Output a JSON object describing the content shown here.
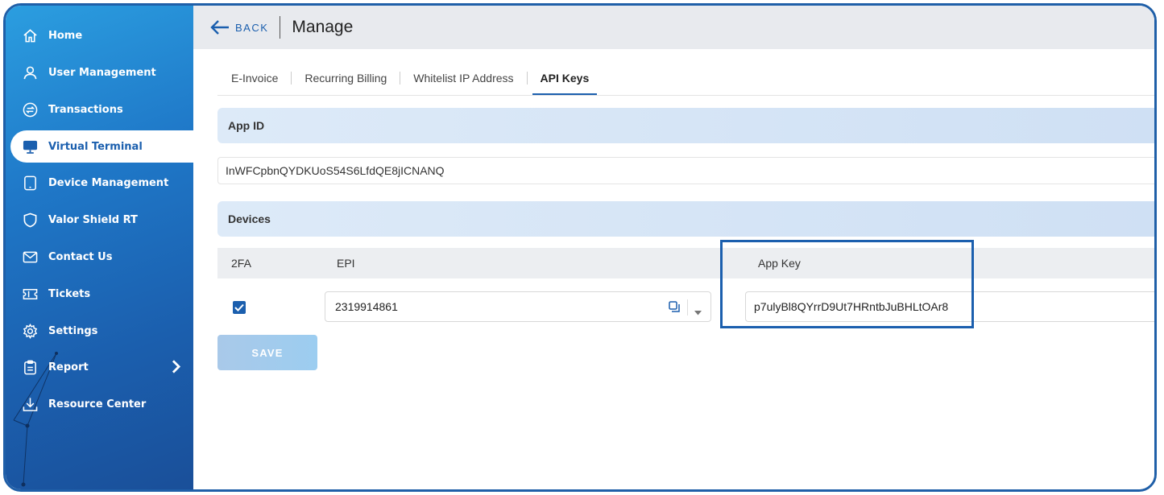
{
  "sidebar": {
    "items": [
      {
        "label": "Home",
        "icon": "home-icon"
      },
      {
        "label": "User Management",
        "icon": "user-icon"
      },
      {
        "label": "Transactions",
        "icon": "transfer-icon"
      },
      {
        "label": "Virtual Terminal",
        "icon": "monitor-icon",
        "active": true
      },
      {
        "label": "Device Management",
        "icon": "device-icon"
      },
      {
        "label": "Valor Shield RT",
        "icon": "shield-icon"
      },
      {
        "label": "Contact Us",
        "icon": "mail-icon"
      },
      {
        "label": "Tickets",
        "icon": "ticket-icon"
      },
      {
        "label": "Settings",
        "icon": "gear-icon"
      },
      {
        "label": "Report",
        "icon": "clipboard-icon",
        "has_submenu": true
      },
      {
        "label": "Resource Center",
        "icon": "download-icon"
      }
    ]
  },
  "header": {
    "back_label": "BACK",
    "title": "Manage"
  },
  "tabs": [
    {
      "label": "E-Invoice"
    },
    {
      "label": "Recurring Billing"
    },
    {
      "label": "Whitelist IP Address"
    },
    {
      "label": "API Keys",
      "active": true
    }
  ],
  "app_id": {
    "section_title": "App ID",
    "value": "InWFCpbnQYDKUoS54S6LfdQE8jICNANQ"
  },
  "devices": {
    "section_title": "Devices",
    "columns": {
      "twofa": "2FA",
      "epi": "EPI",
      "app_key": "App Key"
    },
    "rows": [
      {
        "twofa_checked": true,
        "epi": "2319914861",
        "app_key": "p7ulyBl8QYrrD9Ut7HRntbJuBHLtOAr8"
      }
    ]
  },
  "save_label": "SAVE",
  "colors": {
    "primary": "#1b5fae",
    "sidebar_top": "#2b9ee0",
    "sidebar_bottom": "#1a4f99",
    "section_bg": "#d6e5f6",
    "save_disabled": "#a9c9e9"
  }
}
